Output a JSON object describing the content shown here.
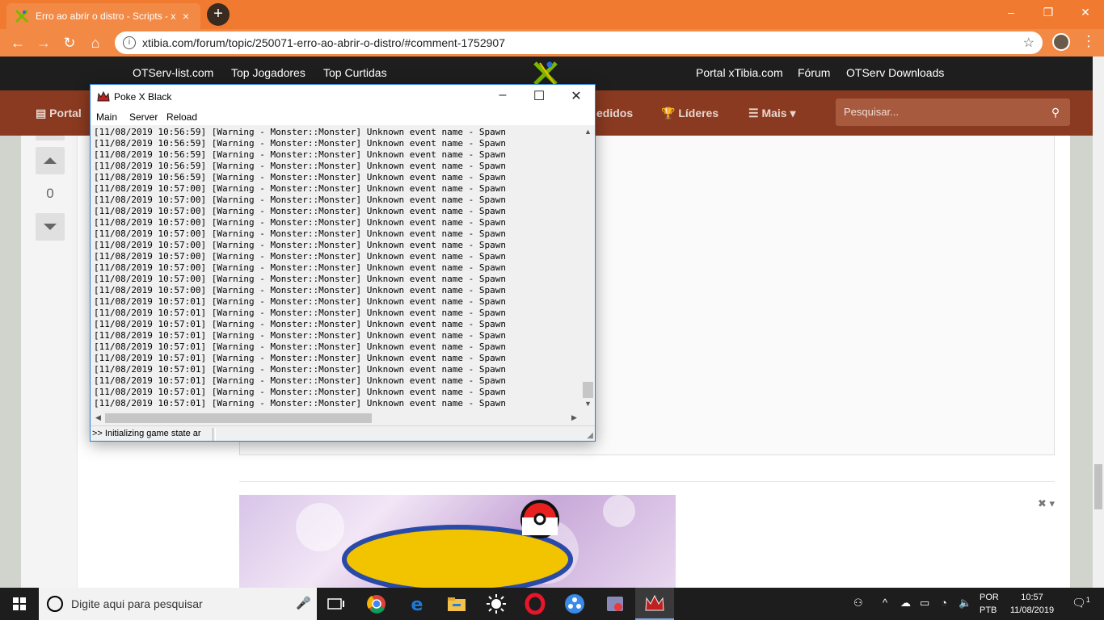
{
  "browser": {
    "tab_title": "Erro ao abrir o distro - Scripts - x",
    "tab_close": "×",
    "new_tab": "+",
    "url": "xtibia.com/forum/topic/250071-erro-ao-abrir-o-distro/#comment-1752907",
    "accent": "#f07a30"
  },
  "site": {
    "top_links": [
      "OTServ-list.com",
      "Top Jogadores",
      "Top Curtidas",
      "Portal xTibia.com",
      "Fórum",
      "OTServ Downloads"
    ],
    "nav": {
      "portal": "Portal",
      "pedidos": "edidos",
      "lideres": "Líderes",
      "mais": "Mais"
    },
    "search_placeholder": "Pesquisar...",
    "vote_count": "0"
  },
  "console": {
    "title": "Poke X Black",
    "menu": [
      "Main",
      "Server",
      "Reload"
    ],
    "log": [
      "[11/08/2019 10:56:59] [Warning - Monster::Monster] Unknown event name - Spawn",
      "[11/08/2019 10:56:59] [Warning - Monster::Monster] Unknown event name - Spawn",
      "[11/08/2019 10:56:59] [Warning - Monster::Monster] Unknown event name - Spawn",
      "[11/08/2019 10:56:59] [Warning - Monster::Monster] Unknown event name - Spawn",
      "[11/08/2019 10:56:59] [Warning - Monster::Monster] Unknown event name - Spawn",
      "[11/08/2019 10:57:00] [Warning - Monster::Monster] Unknown event name - Spawn",
      "[11/08/2019 10:57:00] [Warning - Monster::Monster] Unknown event name - Spawn",
      "[11/08/2019 10:57:00] [Warning - Monster::Monster] Unknown event name - Spawn",
      "[11/08/2019 10:57:00] [Warning - Monster::Monster] Unknown event name - Spawn",
      "[11/08/2019 10:57:00] [Warning - Monster::Monster] Unknown event name - Spawn",
      "[11/08/2019 10:57:00] [Warning - Monster::Monster] Unknown event name - Spawn",
      "[11/08/2019 10:57:00] [Warning - Monster::Monster] Unknown event name - Spawn",
      "[11/08/2019 10:57:00] [Warning - Monster::Monster] Unknown event name - Spawn",
      "[11/08/2019 10:57:00] [Warning - Monster::Monster] Unknown event name - Spawn",
      "[11/08/2019 10:57:00] [Warning - Monster::Monster] Unknown event name - Spawn",
      "[11/08/2019 10:57:01] [Warning - Monster::Monster] Unknown event name - Spawn",
      "[11/08/2019 10:57:01] [Warning - Monster::Monster] Unknown event name - Spawn",
      "[11/08/2019 10:57:01] [Warning - Monster::Monster] Unknown event name - Spawn",
      "[11/08/2019 10:57:01] [Warning - Monster::Monster] Unknown event name - Spawn",
      "[11/08/2019 10:57:01] [Warning - Monster::Monster] Unknown event name - Spawn",
      "[11/08/2019 10:57:01] [Warning - Monster::Monster] Unknown event name - Spawn",
      "[11/08/2019 10:57:01] [Warning - Monster::Monster] Unknown event name - Spawn",
      "[11/08/2019 10:57:01] [Warning - Monster::Monster] Unknown event name - Spawn",
      "[11/08/2019 10:57:01] [Warning - Monster::Monster] Unknown event name - Spawn",
      "[11/08/2019 10:57:01] [Warning - Monster::Monster] Unknown event name - Spawn"
    ],
    "status": ">> Initializing game state ar"
  },
  "taskbar": {
    "search_placeholder": "Digite aqui para pesquisar",
    "lang_1": "POR",
    "lang_2": "PTB",
    "time": "10:57",
    "date": "11/08/2019",
    "notification_count": "1"
  }
}
